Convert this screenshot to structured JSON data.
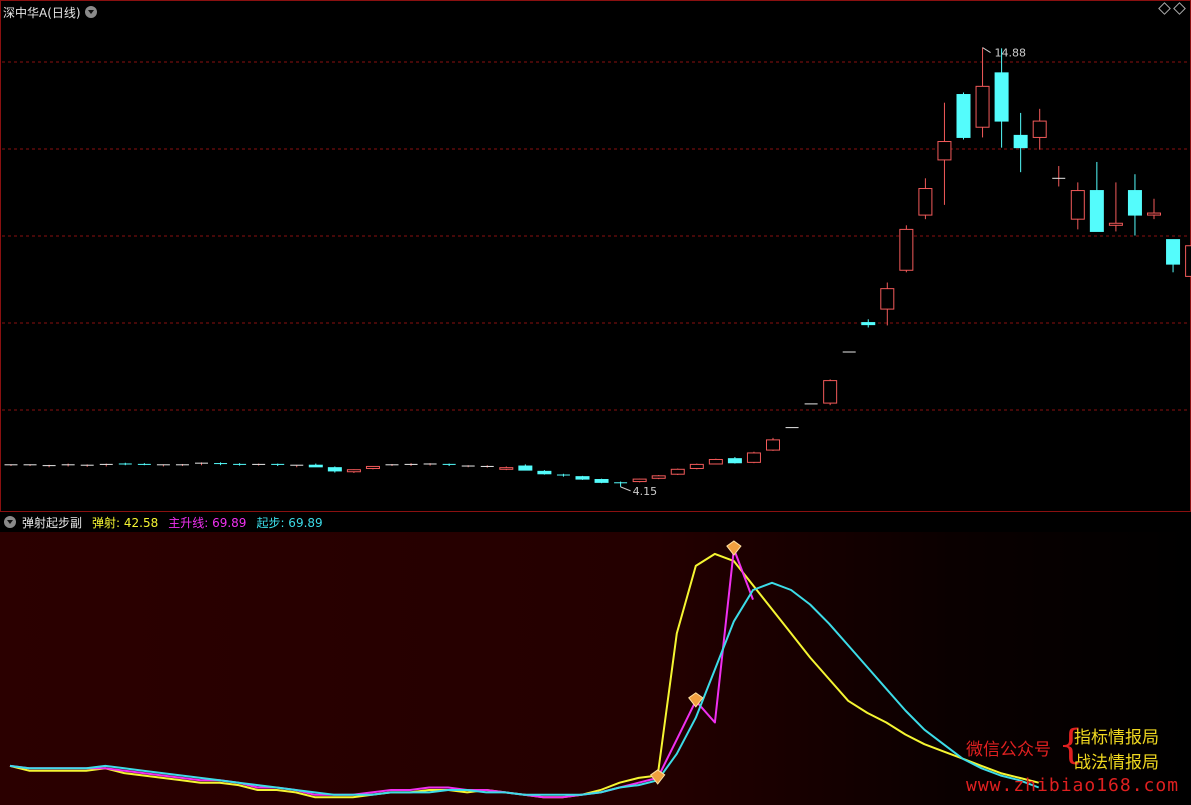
{
  "main": {
    "title": "深中华A(日线)",
    "high_label": "14.88",
    "low_label": "4.15"
  },
  "indicator": {
    "name": "弹射起步副",
    "v1_label": "弹射: 42.58",
    "v2_label": "主升线: 69.89",
    "v3_label": "起步: 69.89"
  },
  "colors": {
    "up": "#f25a5a",
    "down": "#54fcfc",
    "grid": "#8a1010",
    "yellow": "#f5f532",
    "magenta": "#f030f0",
    "cyan": "#3cdce8",
    "signal": "#f0a040"
  },
  "watermark": {
    "left": "微信公众号",
    "right1": "指标情报局",
    "right2": "战法情报局",
    "url": "www.zhibiao168.com"
  },
  "chart_data": [
    {
      "type": "candlestick",
      "ylim": [
        4.0,
        15.5
      ],
      "high": 14.88,
      "low": 4.15,
      "candles": [
        [
          4.68,
          4.7,
          4.66,
          4.69
        ],
        [
          4.68,
          4.7,
          4.66,
          4.69
        ],
        [
          4.64,
          4.69,
          4.63,
          4.67
        ],
        [
          4.67,
          4.72,
          4.65,
          4.69
        ],
        [
          4.66,
          4.7,
          4.64,
          4.68
        ],
        [
          4.67,
          4.72,
          4.65,
          4.7
        ],
        [
          4.71,
          4.74,
          4.68,
          4.7
        ],
        [
          4.7,
          4.73,
          4.68,
          4.69
        ],
        [
          4.68,
          4.7,
          4.65,
          4.69
        ],
        [
          4.68,
          4.71,
          4.66,
          4.69
        ],
        [
          4.7,
          4.75,
          4.68,
          4.73
        ],
        [
          4.72,
          4.75,
          4.68,
          4.69
        ],
        [
          4.7,
          4.73,
          4.67,
          4.69
        ],
        [
          4.69,
          4.72,
          4.67,
          4.7
        ],
        [
          4.7,
          4.72,
          4.66,
          4.67
        ],
        [
          4.65,
          4.68,
          4.63,
          4.68
        ],
        [
          4.68,
          4.72,
          4.66,
          4.64
        ],
        [
          4.62,
          4.65,
          4.5,
          4.54
        ],
        [
          4.52,
          4.58,
          4.49,
          4.57
        ],
        [
          4.6,
          4.66,
          4.58,
          4.65
        ],
        [
          4.68,
          4.71,
          4.66,
          4.69
        ],
        [
          4.69,
          4.73,
          4.66,
          4.7
        ],
        [
          4.69,
          4.73,
          4.67,
          4.71
        ],
        [
          4.7,
          4.72,
          4.66,
          4.67
        ],
        [
          4.65,
          4.68,
          4.63,
          4.66
        ],
        [
          4.65,
          4.68,
          4.62,
          4.65
        ],
        [
          4.58,
          4.65,
          4.56,
          4.62
        ],
        [
          4.66,
          4.7,
          4.6,
          4.56
        ],
        [
          4.53,
          4.56,
          4.45,
          4.47
        ],
        [
          4.44,
          4.47,
          4.4,
          4.42
        ],
        [
          4.4,
          4.42,
          4.32,
          4.34
        ],
        [
          4.33,
          4.35,
          4.24,
          4.26
        ],
        [
          4.25,
          4.28,
          4.15,
          4.22
        ],
        [
          4.28,
          4.35,
          4.26,
          4.34
        ],
        [
          4.36,
          4.44,
          4.34,
          4.42
        ],
        [
          4.46,
          4.6,
          4.44,
          4.58
        ],
        [
          4.6,
          4.72,
          4.58,
          4.7
        ],
        [
          4.71,
          4.84,
          4.7,
          4.82
        ],
        [
          4.84,
          4.88,
          4.72,
          4.74
        ],
        [
          4.75,
          5.01,
          4.73,
          4.98
        ],
        [
          5.05,
          5.35,
          5.03,
          5.3
        ],
        [
          5.6,
          5.6,
          5.6,
          5.6
        ],
        [
          6.18,
          6.18,
          6.18,
          6.18
        ],
        [
          6.2,
          6.78,
          6.15,
          6.75
        ],
        [
          7.45,
          7.45,
          7.45,
          7.45
        ],
        [
          8.17,
          8.25,
          8.05,
          8.12
        ],
        [
          8.5,
          9.15,
          8.1,
          9.0
        ],
        [
          9.45,
          10.55,
          9.4,
          10.45
        ],
        [
          10.8,
          11.7,
          10.7,
          11.45
        ],
        [
          12.15,
          13.55,
          11.05,
          12.6
        ],
        [
          13.75,
          13.8,
          12.65,
          12.7
        ],
        [
          12.95,
          14.9,
          12.7,
          13.95
        ],
        [
          14.28,
          14.88,
          12.45,
          13.1
        ],
        [
          12.75,
          13.3,
          11.85,
          12.45
        ],
        [
          12.7,
          13.4,
          12.4,
          13.1
        ],
        [
          11.7,
          12.0,
          11.5,
          11.7
        ],
        [
          10.7,
          11.6,
          10.45,
          11.4
        ],
        [
          11.4,
          12.1,
          10.75,
          10.4
        ],
        [
          10.55,
          11.6,
          10.4,
          10.6
        ],
        [
          11.4,
          11.8,
          10.3,
          10.8
        ],
        [
          10.8,
          11.2,
          10.7,
          10.85
        ],
        [
          10.2,
          10.2,
          9.4,
          9.6
        ],
        [
          9.3,
          10.05,
          8.7,
          10.05
        ],
        [
          9.9,
          11.4,
          9.8,
          11.3
        ]
      ]
    },
    {
      "type": "line",
      "ylim": [
        0,
        110
      ],
      "series": [
        {
          "name": "弹射",
          "color": "yellow",
          "values": [
            15,
            13,
            13,
            13,
            13,
            14,
            12,
            11,
            10,
            9,
            8,
            8,
            7,
            5,
            5,
            4,
            2,
            2,
            2,
            3,
            4,
            4,
            5,
            5,
            4,
            5,
            4,
            3,
            2,
            2,
            3,
            5,
            8,
            10,
            11,
            70,
            98,
            103,
            100,
            90,
            80,
            70,
            60,
            51,
            42,
            37,
            33,
            28,
            24,
            21,
            18,
            15,
            12,
            10,
            8
          ]
        },
        {
          "name": "主升线",
          "color": "magenta",
          "values": [
            15,
            14,
            14,
            14,
            14,
            14,
            13,
            12,
            11,
            10,
            9,
            9,
            8,
            6,
            6,
            5,
            3,
            3,
            3,
            4,
            5,
            5,
            6,
            6,
            5,
            5,
            4,
            3,
            2,
            2,
            3,
            4,
            6,
            8,
            10,
            26,
            42,
            33,
            105,
            84
          ]
        },
        {
          "name": "起步",
          "color": "cyan",
          "values": [
            15,
            14,
            14,
            14,
            14,
            15,
            14,
            13,
            12,
            11,
            10,
            9,
            8,
            7,
            6,
            5,
            4,
            3,
            3,
            3,
            4,
            4,
            4,
            5,
            5,
            4,
            4,
            3,
            3,
            3,
            3,
            4,
            6,
            7,
            9,
            20,
            35,
            55,
            75,
            88,
            91,
            88,
            82,
            74,
            65,
            56,
            47,
            38,
            30,
            24,
            18,
            14,
            11,
            9,
            6
          ]
        }
      ],
      "signals": [
        10,
        22,
        42
      ]
    }
  ]
}
